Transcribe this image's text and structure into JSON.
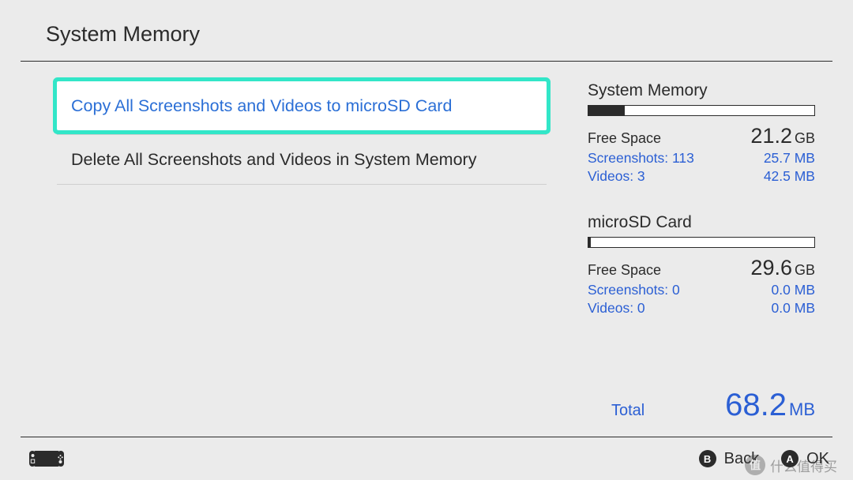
{
  "header": {
    "title": "System Memory"
  },
  "menu": {
    "items": [
      {
        "label": "Copy All Screenshots and Videos to microSD Card",
        "selected": true
      },
      {
        "label": "Delete All Screenshots and Videos in System Memory",
        "selected": false
      }
    ]
  },
  "storage": {
    "system": {
      "title": "System Memory",
      "fill_pct": 16,
      "free_label": "Free Space",
      "free_value": "21.2",
      "free_unit": "GB",
      "screenshots_label": "Screenshots: 113",
      "screenshots_value": "25.7 MB",
      "videos_label": "Videos: 3",
      "videos_value": "42.5 MB"
    },
    "sd": {
      "title": "microSD Card",
      "fill_pct": 1,
      "free_label": "Free Space",
      "free_value": "29.6",
      "free_unit": "GB",
      "screenshots_label": "Screenshots: 0",
      "screenshots_value": "0.0 MB",
      "videos_label": "Videos: 0",
      "videos_value": "0.0 MB"
    },
    "total": {
      "label": "Total",
      "value": "68.2",
      "unit": "MB"
    }
  },
  "footer": {
    "b_glyph": "B",
    "b_label": "Back",
    "a_glyph": "A",
    "a_label": "OK"
  },
  "watermark": {
    "logo": "值",
    "text": "什么值得买"
  }
}
